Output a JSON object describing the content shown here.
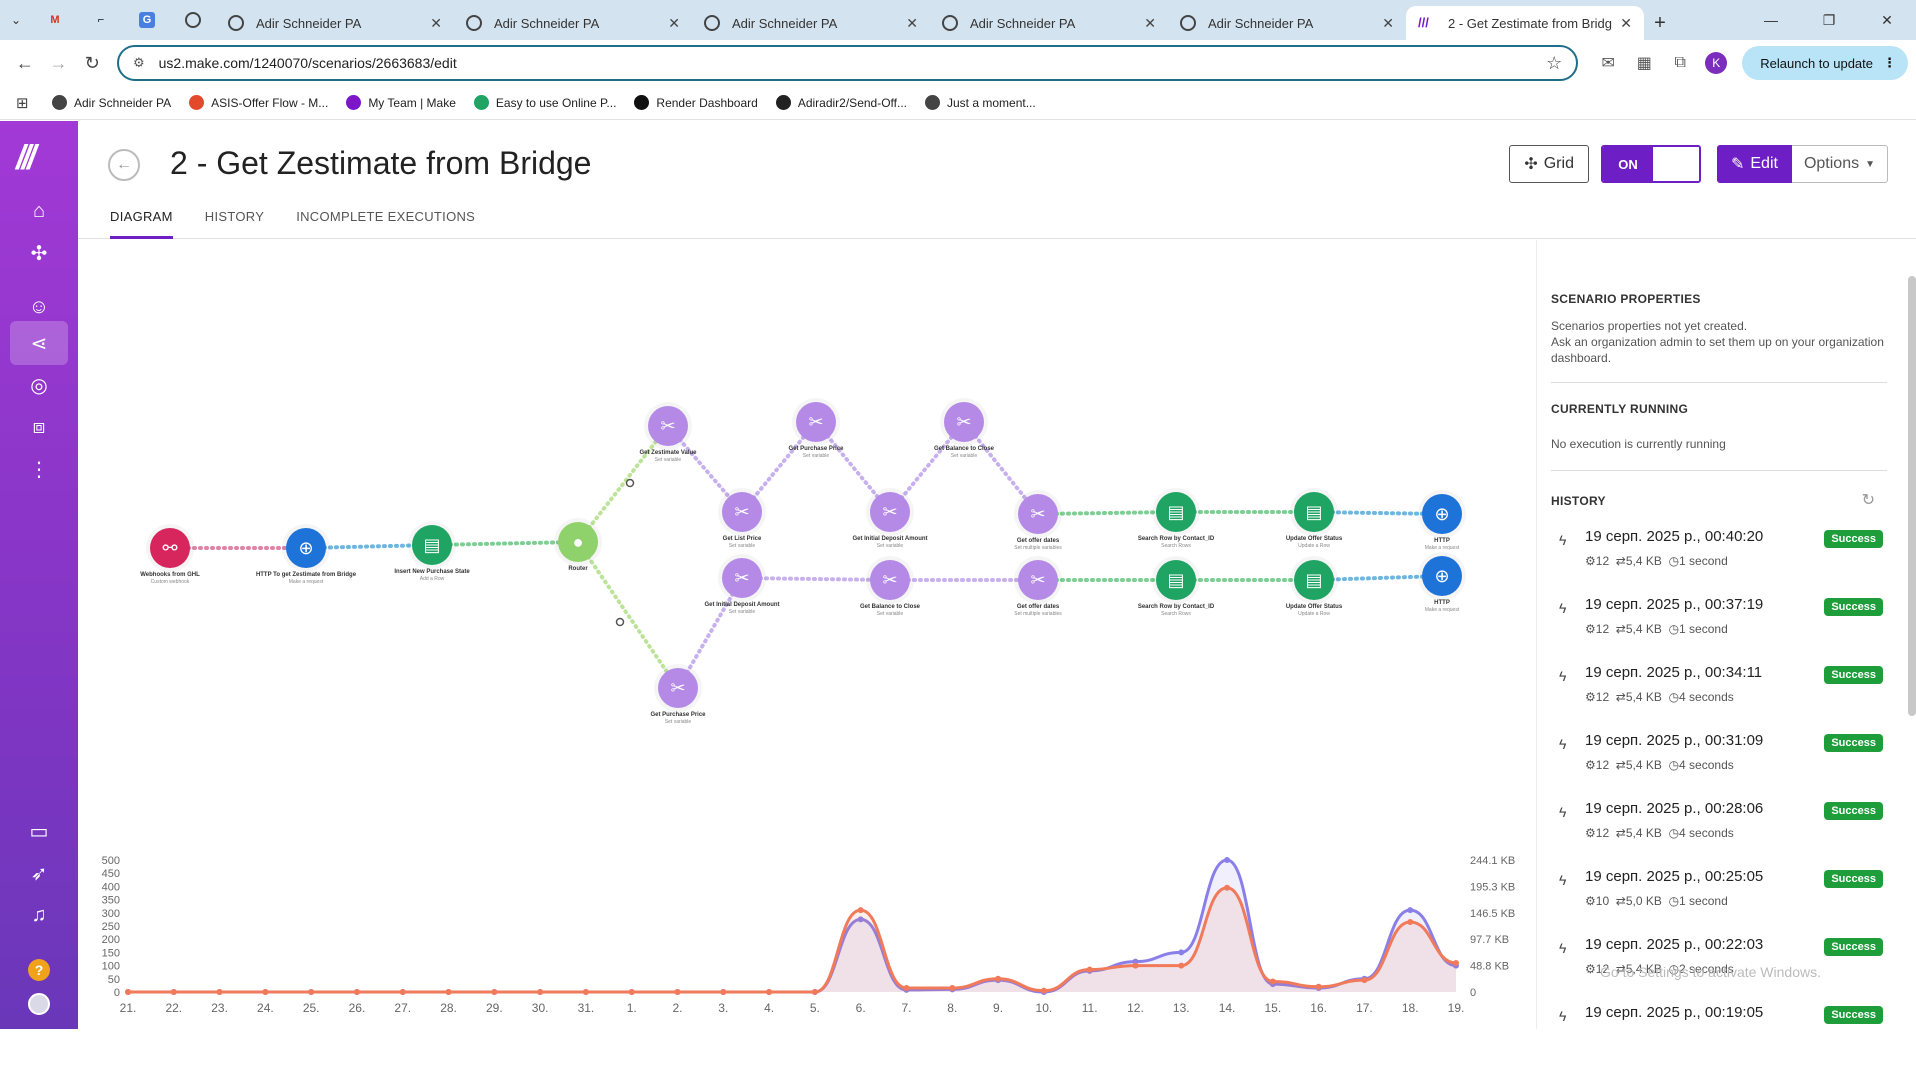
{
  "browser": {
    "tabs": [
      {
        "label": "Adir Schneider PA"
      },
      {
        "label": "Adir Schneider PA"
      },
      {
        "label": "Adir Schneider PA"
      },
      {
        "label": "Adir Schneider PA"
      },
      {
        "label": "Adir Schneider PA"
      },
      {
        "label": "2 - Get Zestimate from Bridge |"
      }
    ],
    "url": "us2.make.com/1240070/scenarios/2663683/edit",
    "profile_initial": "K",
    "relaunch_label": "Relaunch to update",
    "bookmarks": [
      {
        "label": "Adir Schneider PA",
        "color": "#444444"
      },
      {
        "label": "ASIS-Offer Flow - M...",
        "color": "#e24a2b"
      },
      {
        "label": "My Team | Make",
        "color": "#7b17c9"
      },
      {
        "label": "Easy to use Online P...",
        "color": "#1fa463"
      },
      {
        "label": "Render Dashboard",
        "color": "#111111"
      },
      {
        "label": "Adiradir2/Send-Off...",
        "color": "#222222"
      },
      {
        "label": "Just a moment...",
        "color": "#444444"
      }
    ]
  },
  "header": {
    "title": "2 - Get Zestimate from Bridge",
    "tabs": [
      "DIAGRAM",
      "HISTORY",
      "INCOMPLETE EXECUTIONS"
    ],
    "grid_label": "Grid",
    "toggle_label": "ON",
    "edit_label": "Edit",
    "options_label": "Options"
  },
  "nodes": [
    {
      "label": "Webhooks from GHL",
      "sub": "Custom webhook",
      "kind": "hook"
    },
    {
      "label": "HTTP To get Zestimate from Bridge",
      "sub": "Make a request",
      "kind": "http"
    },
    {
      "label": "Insert New Purchase State",
      "sub": "Add a Row",
      "kind": "sheets"
    },
    {
      "label": "Router",
      "sub": "",
      "kind": "router"
    },
    {
      "label": "Get Zestimate Value",
      "sub": "Set variable",
      "kind": "tools"
    },
    {
      "label": "Get List Price",
      "sub": "Set variable",
      "kind": "tools"
    },
    {
      "label": "Get Purchase Price",
      "sub": "Set variable",
      "kind": "tools"
    },
    {
      "label": "Get Initial Deposit Amount",
      "sub": "Set variable",
      "kind": "tools"
    },
    {
      "label": "Get Balance to Close",
      "sub": "Set variable",
      "kind": "tools"
    },
    {
      "label": "Get offer dates",
      "sub": "Set multiple variables",
      "kind": "tools"
    },
    {
      "label": "Search Row by Contact_ID",
      "sub": "Search Rows",
      "kind": "sheets"
    },
    {
      "label": "Update Offer Status",
      "sub": "Update a Row",
      "kind": "sheets"
    },
    {
      "label": "HTTP",
      "sub": "Make a request",
      "kind": "http"
    },
    {
      "label": "Get Initial Deposit Amount",
      "sub": "Set variable",
      "kind": "tools"
    },
    {
      "label": "Get Balance to Close",
      "sub": "Set variable",
      "kind": "tools"
    },
    {
      "label": "Get offer dates",
      "sub": "Set multiple variables",
      "kind": "tools"
    },
    {
      "label": "Search Row by Contact_ID",
      "sub": "Search Rows",
      "kind": "sheets"
    },
    {
      "label": "Update Offer Status",
      "sub": "Update a Row",
      "kind": "sheets"
    },
    {
      "label": "HTTP",
      "sub": "Make a request",
      "kind": "http"
    },
    {
      "label": "Get Purchase Price",
      "sub": "Set variable",
      "kind": "tools"
    }
  ],
  "right_panel": {
    "props_title": "SCENARIO PROPERTIES",
    "props_text_1": "Scenarios properties not yet created.",
    "props_text_2": "Ask an organization admin to set them up on your organization dashboard.",
    "running_title": "CURRENTLY RUNNING",
    "running_text": "No execution is currently running",
    "history_title": "HISTORY",
    "history": [
      {
        "date": "19 серп. 2025 р., 00:40:20",
        "ops": "12",
        "size": "5,4 KB",
        "dur": "1 second",
        "status": "Success"
      },
      {
        "date": "19 серп. 2025 р., 00:37:19",
        "ops": "12",
        "size": "5,4 KB",
        "dur": "1 second",
        "status": "Success"
      },
      {
        "date": "19 серп. 2025 р., 00:34:11",
        "ops": "12",
        "size": "5,4 KB",
        "dur": "4 seconds",
        "status": "Success"
      },
      {
        "date": "19 серп. 2025 р., 00:31:09",
        "ops": "12",
        "size": "5,4 KB",
        "dur": "4 seconds",
        "status": "Success"
      },
      {
        "date": "19 серп. 2025 р., 00:28:06",
        "ops": "12",
        "size": "5,4 KB",
        "dur": "4 seconds",
        "status": "Success"
      },
      {
        "date": "19 серп. 2025 р., 00:25:05",
        "ops": "10",
        "size": "5,0 KB",
        "dur": "1 second",
        "status": "Success"
      },
      {
        "date": "19 серп. 2025 р., 00:22:03",
        "ops": "12",
        "size": "5,4 KB",
        "dur": "2 seconds",
        "status": "Success"
      },
      {
        "date": "19 серп. 2025 р., 00:19:05",
        "ops": "",
        "size": "",
        "dur": "",
        "status": "Success"
      }
    ]
  },
  "watermark": "Go to Settings to activate Windows.",
  "chart_data": {
    "type": "area",
    "categories": [
      "21.",
      "22.",
      "23.",
      "24.",
      "25.",
      "26.",
      "27.",
      "28.",
      "29.",
      "30.",
      "31.",
      "1.",
      "2.",
      "3.",
      "4.",
      "5.",
      "6.",
      "7.",
      "8.",
      "9.",
      "10.",
      "11.",
      "12.",
      "13.",
      "14.",
      "15.",
      "16.",
      "17.",
      "18.",
      "19."
    ],
    "y_ticks_left": [
      "0",
      "50",
      "100",
      "150",
      "200",
      "250",
      "300",
      "350",
      "400",
      "450",
      "500"
    ],
    "y_ticks_right": [
      "0",
      "48.8 KB",
      "97.7 KB",
      "146.5 KB",
      "195.3 KB",
      "244.1 KB"
    ],
    "ylim": [
      0,
      500
    ],
    "series": [
      {
        "values": [
          0,
          0,
          0,
          0,
          0,
          0,
          0,
          0,
          0,
          0,
          0,
          0,
          0,
          0,
          0,
          0,
          275,
          8,
          10,
          45,
          0,
          80,
          115,
          150,
          500,
          30,
          15,
          50,
          310,
          100
        ],
        "color": "#8a7fe8"
      },
      {
        "values": [
          0,
          0,
          0,
          0,
          0,
          0,
          0,
          0,
          0,
          0,
          0,
          0,
          0,
          0,
          0,
          0,
          310,
          15,
          15,
          50,
          5,
          85,
          100,
          100,
          395,
          40,
          20,
          45,
          265,
          110
        ],
        "color": "#f07a5a"
      }
    ]
  }
}
